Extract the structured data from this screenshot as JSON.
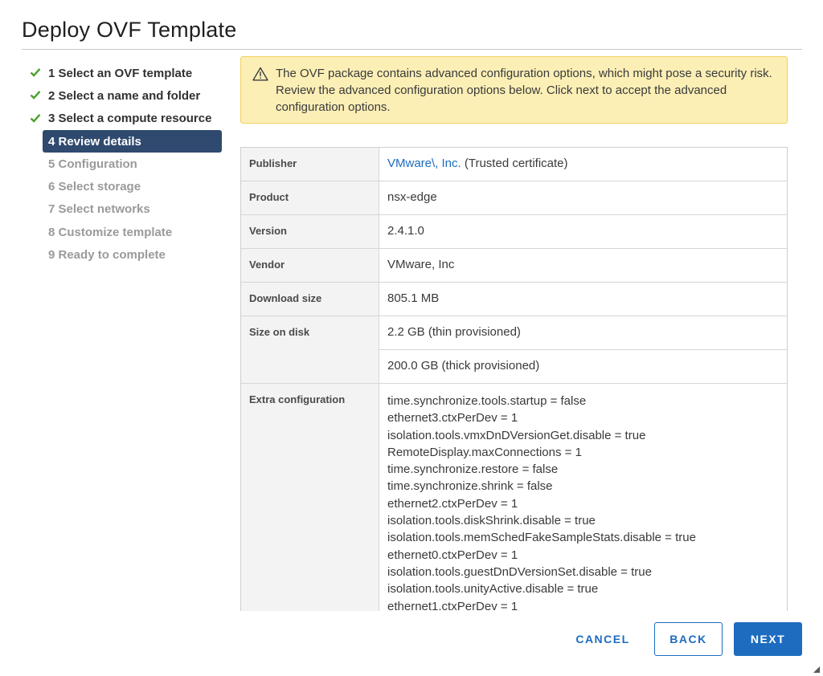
{
  "dialog": {
    "title": "Deploy OVF Template"
  },
  "steps": [
    {
      "label": "1 Select an OVF template",
      "state": "done"
    },
    {
      "label": "2 Select a name and folder",
      "state": "done"
    },
    {
      "label": "3 Select a compute resource",
      "state": "done"
    },
    {
      "label": "4 Review details",
      "state": "active"
    },
    {
      "label": "5 Configuration",
      "state": "pending"
    },
    {
      "label": "6 Select storage",
      "state": "pending"
    },
    {
      "label": "7 Select networks",
      "state": "pending"
    },
    {
      "label": "8 Customize template",
      "state": "pending"
    },
    {
      "label": "9 Ready to complete",
      "state": "pending"
    }
  ],
  "warning": {
    "icon": "warning-triangle-icon",
    "text": "The OVF package contains advanced configuration options, which might pose a security risk. Review the advanced configuration options below. Click next to accept the advanced configuration options."
  },
  "details": {
    "publisher": {
      "label": "Publisher",
      "link": "VMware\\, Inc.",
      "suffix": " (Trusted certificate)"
    },
    "product": {
      "label": "Product",
      "value": "nsx-edge"
    },
    "version": {
      "label": "Version",
      "value": "2.4.1.0"
    },
    "vendor": {
      "label": "Vendor",
      "value": "VMware, Inc"
    },
    "download_size": {
      "label": "Download size",
      "value": "805.1 MB"
    },
    "size_on_disk": {
      "label": "Size on disk",
      "thin": "2.2 GB (thin provisioned)",
      "thick": "200.0 GB (thick provisioned)"
    },
    "extra_configuration": {
      "label": "Extra configuration",
      "lines": [
        "time.synchronize.tools.startup = false",
        "ethernet3.ctxPerDev = 1",
        "isolation.tools.vmxDnDVersionGet.disable = true",
        "RemoteDisplay.maxConnections = 1",
        "time.synchronize.restore = false",
        "time.synchronize.shrink = false",
        "ethernet2.ctxPerDev = 1",
        "isolation.tools.diskShrink.disable = true",
        "isolation.tools.memSchedFakeSampleStats.disable = true",
        "ethernet0.ctxPerDev = 1",
        "isolation.tools.guestDnDVersionSet.disable = true",
        "isolation.tools.unityActive.disable = true",
        "ethernet1.ctxPerDev = 1"
      ]
    }
  },
  "footer": {
    "cancel_label": "CANCEL",
    "back_label": "BACK",
    "next_label": "NEXT"
  },
  "colors": {
    "accent": "#1d6cbf",
    "active_step_bg": "#2f4a6e",
    "check": "#4aa02c",
    "warning_bg": "#fbefb6"
  }
}
